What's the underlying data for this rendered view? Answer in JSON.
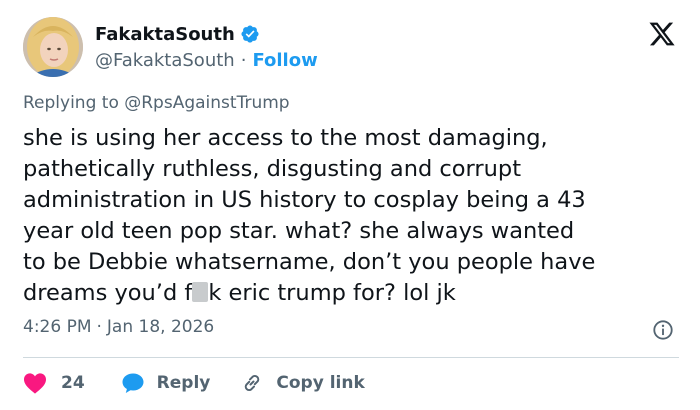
{
  "author": {
    "display_name": "FakaktaSouth",
    "handle": "@FakaktaSouth",
    "separator": "·",
    "follow_label": "Follow",
    "verified_icon": "verified-badge-icon",
    "verified_color": "#1d9bf0"
  },
  "brand": {
    "logo_icon": "x-logo-icon"
  },
  "reply_context": {
    "prefix": "Replying to",
    "handle": "@RpsAgainstTrump"
  },
  "tweet": {
    "lines": [
      "she is using her access to the most damaging,",
      "pathetically ruthless, disgusting and corrupt",
      "administration in US history to cosplay being a 43",
      "year old teen pop star. what? she always wanted",
      "to be Debbie whatsername, don’t you people have"
    ],
    "last_line": {
      "before": "dreams you’d f",
      "after": "k eric trump for? lol jk"
    }
  },
  "meta": {
    "time": "4:26 PM",
    "separator": "·",
    "date": "Jan 18, 2026",
    "info_icon": "info-icon"
  },
  "actions": {
    "like": {
      "icon": "heart-icon",
      "count": "24",
      "color": "#f91880"
    },
    "reply": {
      "icon": "reply-bubble-icon",
      "label": "Reply",
      "color": "#1d9bf0"
    },
    "copy_link": {
      "icon": "link-icon",
      "label": "Copy link"
    }
  },
  "colors": {
    "text": "#0f1419",
    "secondary": "#536471",
    "accent": "#1d9bf0",
    "divider": "#cfd9de"
  }
}
